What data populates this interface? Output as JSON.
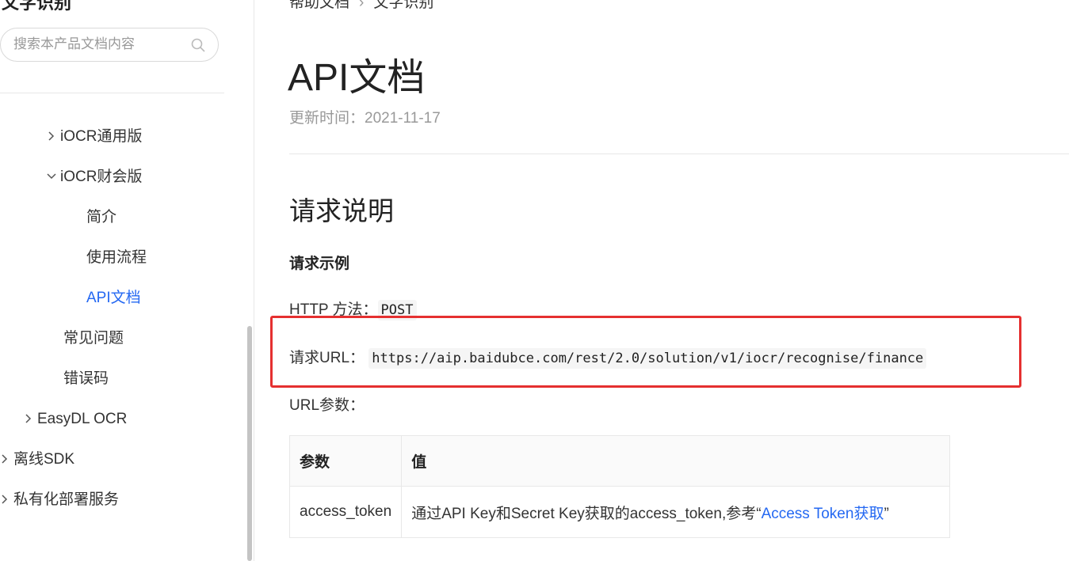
{
  "sidebar": {
    "title": "文字识别",
    "search": {
      "placeholder": "搜索本产品文档内容",
      "value": ""
    },
    "items": [
      {
        "label": "iOCR通用版",
        "state": "collapsed"
      },
      {
        "label": "iOCR财会版",
        "state": "expanded"
      },
      {
        "label": "简介"
      },
      {
        "label": "使用流程"
      },
      {
        "label": "API文档",
        "active": true
      },
      {
        "label": "常见问题"
      },
      {
        "label": "错误码"
      },
      {
        "label": "EasyDL OCR",
        "state": "collapsed"
      },
      {
        "label": "离线SDK",
        "state": "collapsed"
      },
      {
        "label": "私有化部署服务",
        "state": "collapsed"
      }
    ]
  },
  "breadcrumb": [
    "帮助文档",
    "文字识别"
  ],
  "page": {
    "title": "API文档",
    "update_label": "更新时间：",
    "update_date": "2021-11-17",
    "section_title": "请求说明",
    "sub_title": "请求示例",
    "http_method_label": "HTTP 方法：",
    "http_method": "POST",
    "request_url_label": "请求URL：",
    "request_url": "https://aip.baidubce.com/rest/2.0/solution/v1/iocr/recognise/finance",
    "url_params_label": "URL参数："
  },
  "params_table": {
    "headers": [
      "参数",
      "值"
    ],
    "rows": [
      {
        "param": "access_token",
        "value_prefix": "通过API Key和Secret Key获取的access_token,参考“",
        "value_link": "Access Token获取",
        "value_suffix": "”"
      }
    ]
  },
  "colors": {
    "accent": "#2468f2",
    "highlight_border": "#e53030",
    "muted_text": "#999999"
  },
  "icons": {
    "search": "search-icon",
    "menu": "hamburger-menu-icon",
    "collapsed": "chevron-right-icon",
    "expanded": "chevron-down-icon"
  }
}
